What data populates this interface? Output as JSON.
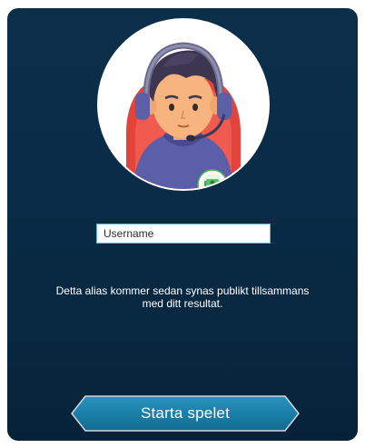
{
  "avatar": {
    "icon": "gamer-avatar-icon",
    "badge_icon": "money-badge-icon"
  },
  "username_field": {
    "placeholder": "Username",
    "value": ""
  },
  "info_text": {
    "line1": "Detta alias kommer sedan synas publikt tillsammans",
    "line2": "med ditt resultat."
  },
  "start_button": {
    "label": "Starta spelet"
  },
  "colors": {
    "panel": "#0a2c46",
    "button": "#1b7fa8",
    "button_border": "#cfd8df",
    "input_border": "#5fb8e8"
  }
}
